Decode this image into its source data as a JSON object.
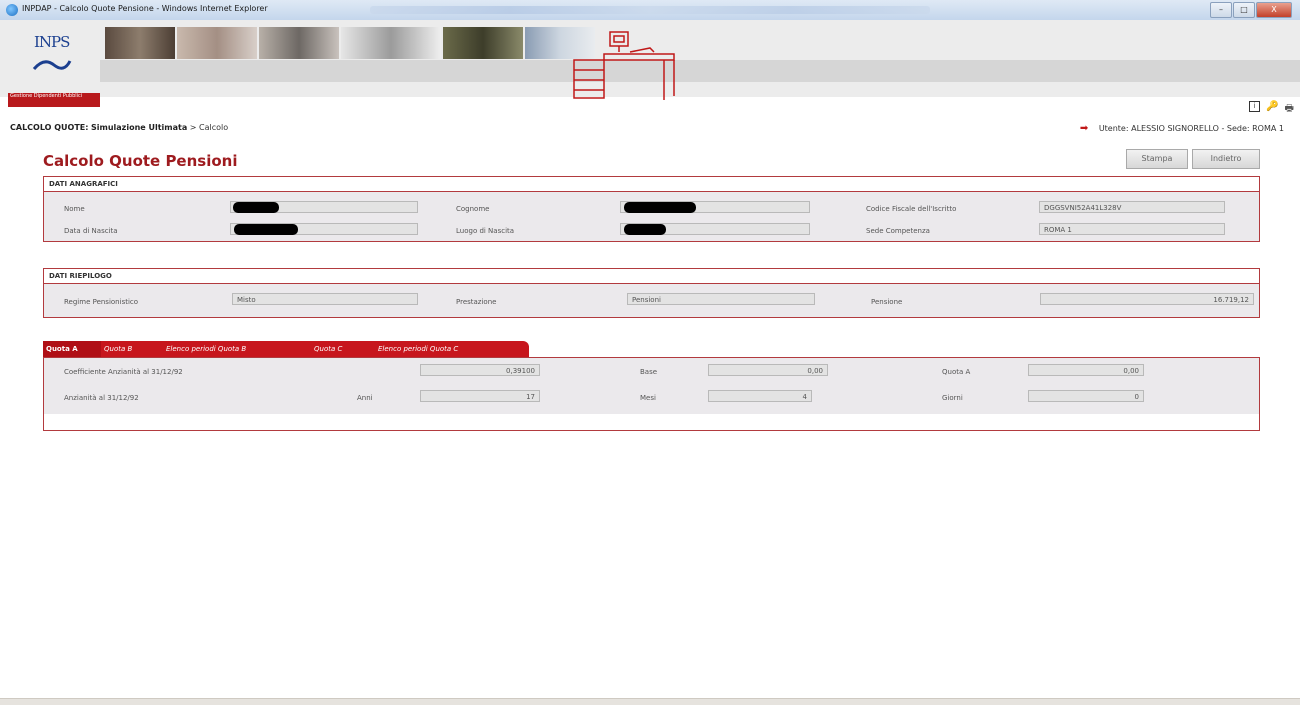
{
  "window": {
    "title": "INPDAP - Calcolo Quote Pensione - Windows Internet Explorer",
    "buttons": {
      "min": "–",
      "max": "□",
      "close": "X"
    }
  },
  "banner": {
    "logo_text": "INPS",
    "logo_caption": "Gestione Dipendenti Pubblici",
    "tools": {
      "info": "i",
      "key": "🔑",
      "print": "🖶"
    }
  },
  "breadcrumb": {
    "root": "CALCOLO QUOTE:",
    "section": "Simulazione Ultimata",
    "separator": ">",
    "current": "Calcolo"
  },
  "user": {
    "label": "Utente:",
    "name": "ALESSIO SIGNORELLO",
    "sede_label": "- Sede:",
    "sede": "ROMA 1"
  },
  "page": {
    "title": "Calcolo Quote Pensioni",
    "print_button": "Stampa",
    "back_button": "Indietro"
  },
  "anagrafici": {
    "header": "DATI ANAGRAFICI",
    "nome_label": "Nome",
    "cognome_label": "Cognome",
    "cf_label": "Codice Fiscale dell'Iscritto",
    "cf_value": "DGGSVNI52A41L328V",
    "nascita_label": "Data di Nascita",
    "luogo_label": "Luogo di Nascita",
    "sede_label": "Sede Competenza",
    "sede_value": "ROMA 1"
  },
  "riepilogo": {
    "header": "DATI RIEPILOGO",
    "regime_label": "Regime Pensionistico",
    "regime_value": "Misto",
    "prestazione_label": "Prestazione",
    "prestazione_value": "Pensioni",
    "pensione_label": "Pensione",
    "pensione_value": "16.719,12"
  },
  "tabs": [
    {
      "label": "Quota A"
    },
    {
      "label": "Quota B"
    },
    {
      "label": "Elenco periodi Quota B"
    },
    {
      "label": "Quota C"
    },
    {
      "label": "Elenco periodi Quota C"
    }
  ],
  "quota_a": {
    "coeff_label": "Coefficiente Anzianità al 31/12/92",
    "coeff_value": "0,39100",
    "base_label": "Base",
    "base_value": "0,00",
    "quota_label": "Quota A",
    "quota_value": "0,00",
    "anz_label": "Anzianità al 31/12/92",
    "anni_label": "Anni",
    "anni_value": "17",
    "mesi_label": "Mesi",
    "mesi_value": "4",
    "giorni_label": "Giorni",
    "giorni_value": "0"
  },
  "colors": {
    "accent": "#9e1b1f",
    "tab": "#c7161d",
    "panel_bg": "#ebe9ec"
  }
}
